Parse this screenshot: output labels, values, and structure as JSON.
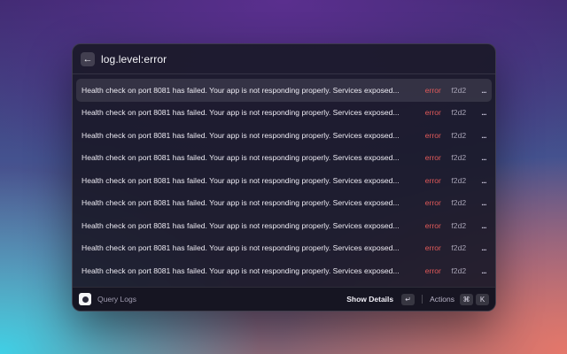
{
  "header": {
    "back_icon": "arrow-left-icon",
    "back_glyph": "←",
    "query": "log.level:error"
  },
  "rows": [
    {
      "message": "Health check on port 8081 has failed. Your app is not responding properly. Services exposed...",
      "level": "error",
      "host": "f2d2",
      "more": "..."
    },
    {
      "message": "Health check on port 8081 has failed. Your app is not responding properly. Services exposed...",
      "level": "error",
      "host": "f2d2",
      "more": "..."
    },
    {
      "message": "Health check on port 8081 has failed. Your app is not responding properly. Services exposed...",
      "level": "error",
      "host": "f2d2",
      "more": "..."
    },
    {
      "message": "Health check on port 8081 has failed. Your app is not responding properly. Services exposed...",
      "level": "error",
      "host": "f2d2",
      "more": "..."
    },
    {
      "message": "Health check on port 8081 has failed. Your app is not responding properly. Services exposed...",
      "level": "error",
      "host": "f2d2",
      "more": "..."
    },
    {
      "message": "Health check on port 8081 has failed. Your app is not responding properly. Services exposed...",
      "level": "error",
      "host": "f2d2",
      "more": "..."
    },
    {
      "message": "Health check on port 8081 has failed. Your app is not responding properly. Services exposed...",
      "level": "error",
      "host": "f2d2",
      "more": "..."
    },
    {
      "message": "Health check on port 8081 has failed. Your app is not responding properly. Services exposed...",
      "level": "error",
      "host": "f2d2",
      "more": "..."
    },
    {
      "message": "Health check on port 8081 has failed. Your app is not responding properly. Services exposed...",
      "level": "error",
      "host": "f2d2",
      "more": "..."
    }
  ],
  "footer": {
    "app_icon": "query-logs-app-icon",
    "title": "Query Logs",
    "primary_action": "Show Details",
    "primary_key": "↵",
    "actions_label": "Actions",
    "actions_keys": [
      "⌘",
      "K"
    ]
  },
  "colors": {
    "error": "#e25a5a",
    "selected_row": "rgba(255,255,255,0.10)"
  }
}
